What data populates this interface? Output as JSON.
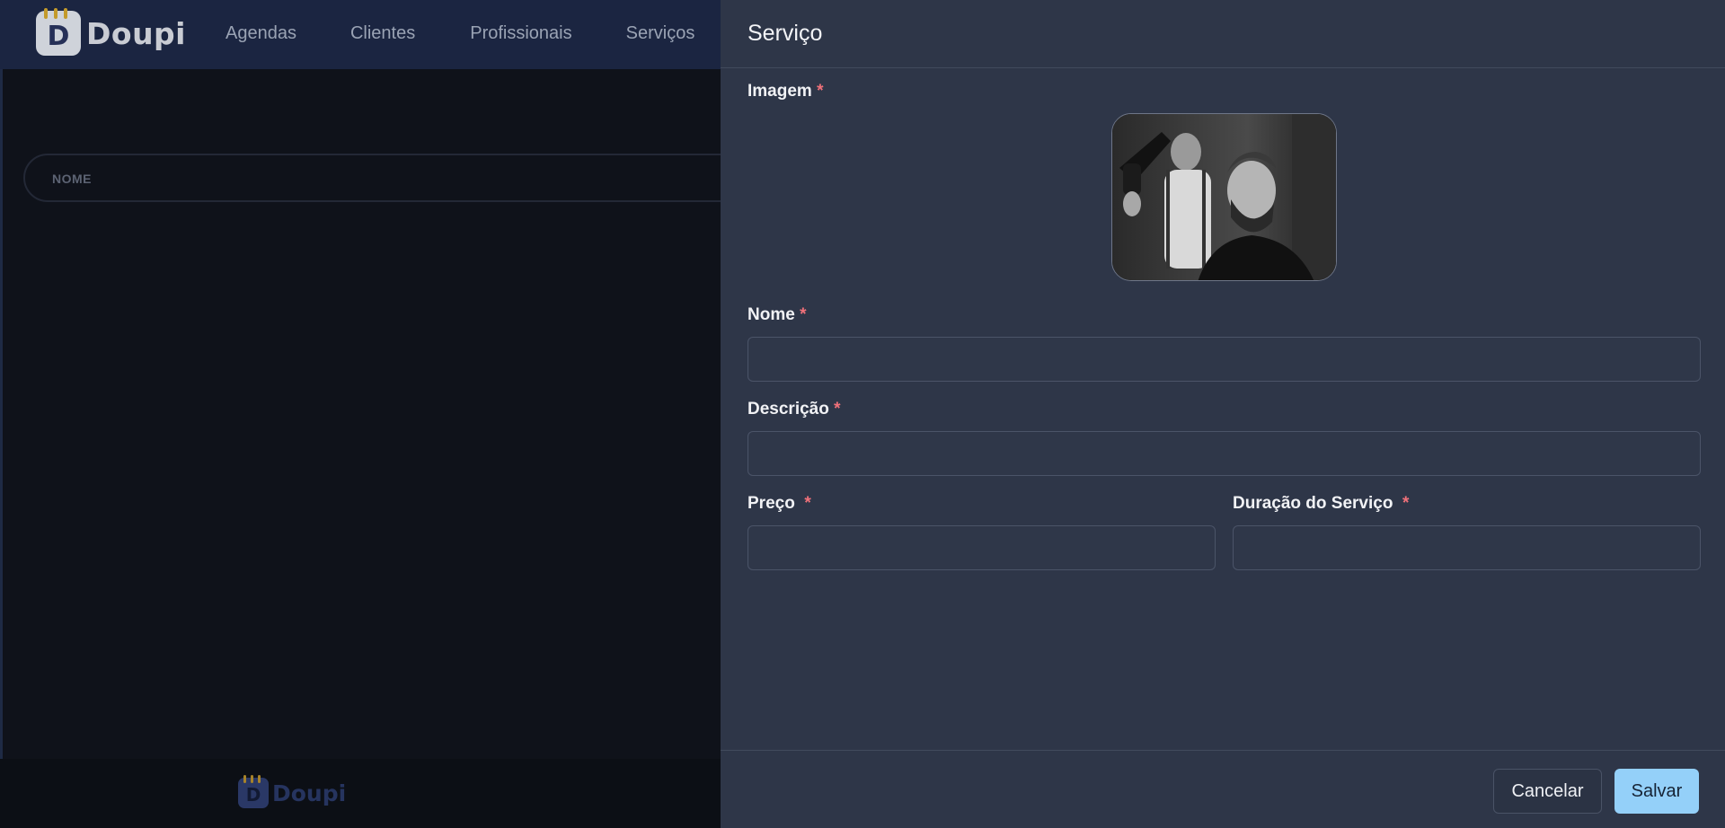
{
  "app": {
    "brand": "Doupi",
    "brand_letter": "D",
    "nav": [
      "Agendas",
      "Clientes",
      "Profissionais",
      "Serviços"
    ],
    "table_header": "NOME",
    "footer_brand": "Doupi"
  },
  "drawer": {
    "title": "Serviço",
    "fields": {
      "imagem_label": "Imagem",
      "nome_label": "Nome",
      "nome_value": "",
      "descricao_label": "Descrição",
      "descricao_value": "",
      "preco_label": "Preço",
      "preco_value": "",
      "duracao_label": "Duração do Serviço",
      "duracao_value": ""
    },
    "required_mark": "*",
    "buttons": {
      "cancel": "Cancelar",
      "save": "Salvar"
    }
  },
  "colors": {
    "accent": "#94d0f9",
    "required": "#f0717a",
    "drawer_bg": "#2e3648"
  },
  "icons": {
    "brand_logo": "calendar-d-logo-icon"
  }
}
